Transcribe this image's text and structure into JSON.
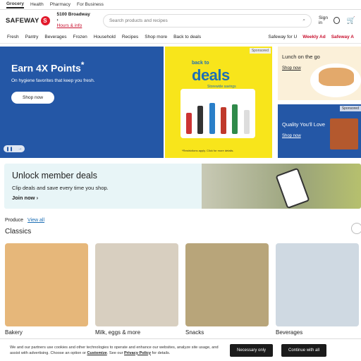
{
  "top_tabs": [
    "Grocery",
    "Health",
    "Pharmacy",
    "For Business"
  ],
  "header": {
    "logo": "SAFEWAY",
    "store_address": "5100 Broadway",
    "store_hours_link": "Hours & info",
    "search_placeholder": "Search products and recipes",
    "signin_label": "Sign in"
  },
  "nav": {
    "items": [
      "Fresh",
      "Pantry",
      "Beverages",
      "Frozen",
      "Household",
      "Recipes",
      "Shop more",
      "Back to deals"
    ],
    "right": [
      "Safeway for U",
      "Weekly Ad",
      "Safeway A"
    ]
  },
  "hero": {
    "title": "Earn 4X Points",
    "title_mark": "*",
    "subtitle": "On hygiene favorites that keep you fresh.",
    "button": "Shop now",
    "deals_small": "back to",
    "deals_big": "deals",
    "storewide": "Storewide savings",
    "sponsored": "Sponsored",
    "fine_print": "*Restrictions apply. Click for more details."
  },
  "side_promos": {
    "top_title": "Lunch on the go",
    "top_link": "Shop now",
    "bottom_title": "Quality You'll Love",
    "bottom_link": "Shop now",
    "bottom_sponsored": "Sponsored"
  },
  "member": {
    "title": "Unlock member deals",
    "text": "Clip deals and save every time you shop.",
    "link": "Join now"
  },
  "produce": {
    "label": "Produce",
    "view_all": "View all",
    "section_title": "Classics"
  },
  "categories": [
    {
      "label": "Bakery",
      "color": "#e6b77a"
    },
    {
      "label": "Milk, eggs & more",
      "color": "#d8cfc0"
    },
    {
      "label": "Snacks",
      "color": "#b8a57a"
    },
    {
      "label": "Beverages",
      "color": "#cfd9e2"
    }
  ],
  "cookie": {
    "text_1": "We and our partners use cookies and other technologies to operate and enhance our websites, analyze site usage, and assist with advertising. Choose an option or",
    "customize": "Customize",
    "text_2": ". See our",
    "privacy": "Privacy Policy",
    "text_3": "for details.",
    "btn_necessary": "Necessary only",
    "btn_all": "Continue with all"
  },
  "colors": {
    "brand_red": "#e21a2c",
    "promo_blue": "#2457a6",
    "promo_yellow": "#f8e51b"
  }
}
